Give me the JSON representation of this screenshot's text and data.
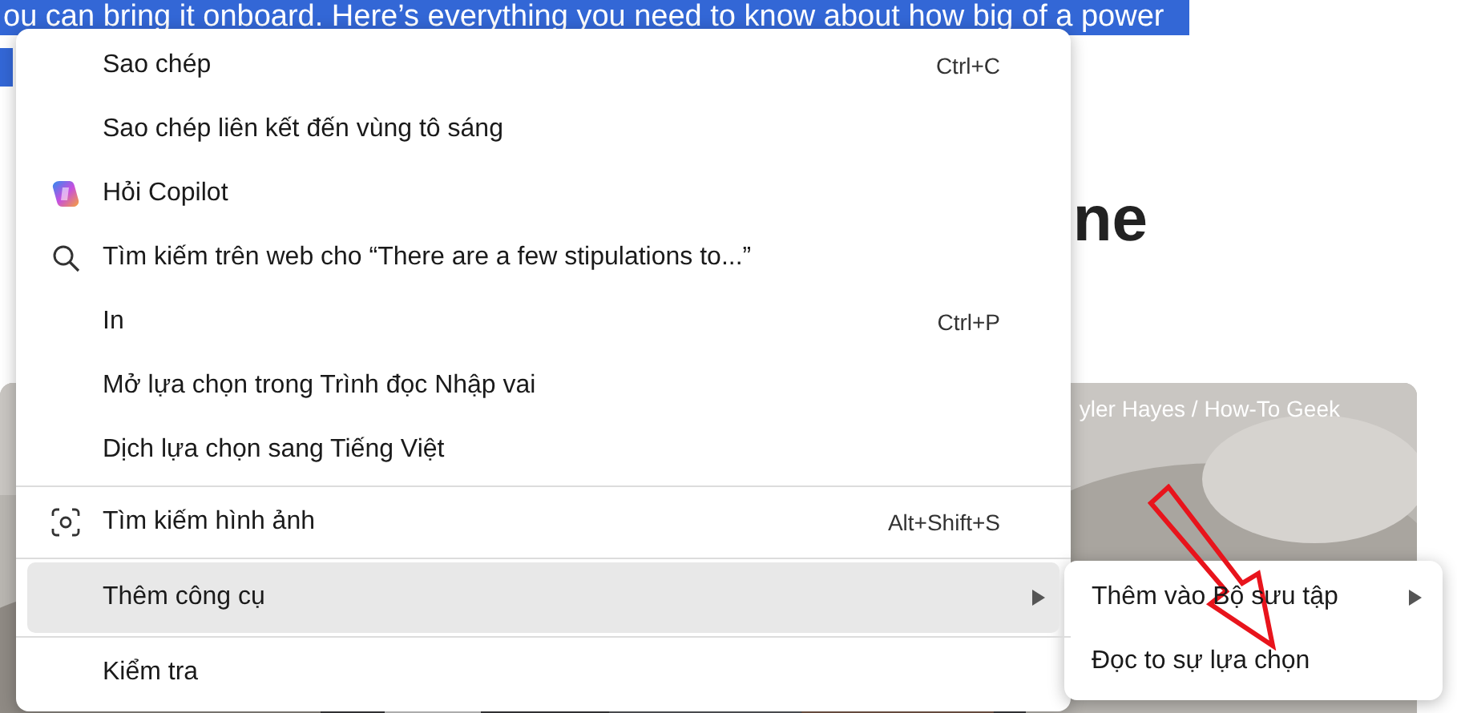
{
  "article": {
    "selected_line": "ou can bring it onboard. Here’s everything you need to know about how big of a power",
    "heading": {
      "line_1_end": "ne"
    },
    "picture": {
      "kind": "picture",
      "caption": "yler Hayes / How-To Geek"
    }
  },
  "context_menu": {
    "items": [
      {
        "kind": "item",
        "label": "Sao chép",
        "shortcut": "Ctrl+C",
        "selected": false
      },
      {
        "kind": "item",
        "label": "Sao chép liên kết đến vùng tô sáng",
        "selected": false
      },
      {
        "kind": "copilot",
        "label": "Hỏi Copilot",
        "selected": false
      },
      {
        "kind": "search",
        "label": "Tìm kiếm trên web cho “There are a few stipulations to...”",
        "selected": false
      },
      {
        "kind": "item",
        "label": "In",
        "shortcut": "Ctrl+P",
        "selected": false
      },
      {
        "kind": "item",
        "label": "Mở lựa chọn trong Trình đọc Nhập vai",
        "selected": false
      },
      {
        "kind": "item",
        "label": "Dịch lựa chọn sang Tiếng Việt",
        "selected": false
      },
      {
        "kind": "separator"
      },
      {
        "kind": "lens",
        "label": "Tìm kiếm hình ảnh",
        "shortcut": "Alt+Shift+S",
        "selected": false
      },
      {
        "kind": "separator"
      },
      {
        "kind": "item",
        "label": "Thêm công cụ",
        "submenu": true,
        "selected": true
      },
      {
        "kind": "separator"
      },
      {
        "kind": "item",
        "label": "Kiểm tra",
        "selected": false
      }
    ]
  },
  "submenu": {
    "items": [
      {
        "kind": "item",
        "label": "Thêm vào Bộ sưu tập",
        "submenu": true,
        "selected": false
      },
      {
        "kind": "item",
        "label": "Đọc to sự lựa chọn",
        "selected": false
      }
    ]
  }
}
